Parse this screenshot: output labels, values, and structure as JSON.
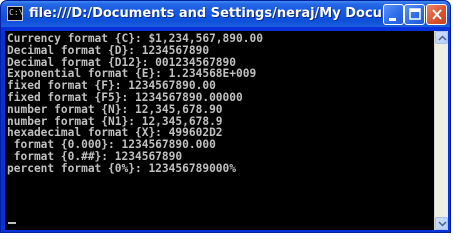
{
  "window": {
    "title": "file:///D:/Documents and Settings/neraj/My Documents/..."
  },
  "console": {
    "lines": [
      "Currency format {C}: $1,234,567,890.00",
      "Decimal format {D}: 1234567890",
      "Decimal format {D12}: 001234567890",
      "Exponential format {E}: 1.234568E+009",
      "fixed format {F}: 1234567890.00",
      "fixed format {F5}: 1234567890.00000",
      "number format {N}: 12,345,678.90",
      "number format {N1}: 12,345,678.9",
      "hexadecimal format {X}: 499602D2",
      " format {0.000}: 1234567890.000",
      " format {0.##}: 1234567890",
      "percent format {0%}: 123456789000%"
    ]
  },
  "icons": {
    "app": "console-icon",
    "minimize": "minimize-icon",
    "maximize": "maximize-icon",
    "close": "close-icon"
  },
  "colors": {
    "titlebar": "#0d4fd8",
    "console_bg": "#000000",
    "console_text": "#c0c0c0",
    "close_button": "#dc5430"
  }
}
